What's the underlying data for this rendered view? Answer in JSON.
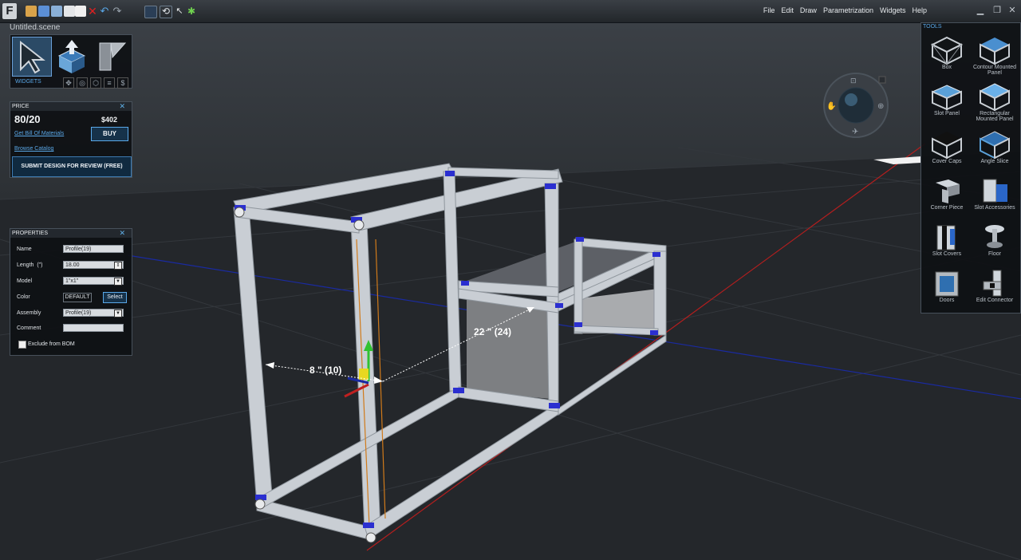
{
  "app": {
    "logo_letter": "F",
    "file_name": "Untitled.scene"
  },
  "menu": [
    "File",
    "Edit",
    "Draw",
    "Parametrization",
    "Widgets",
    "Help"
  ],
  "widgets": {
    "label": "WIDGETS"
  },
  "price": {
    "title": "PRICE",
    "brand": "80/20",
    "amount": "$402",
    "bom_link": "Get Bill Of Materials",
    "buy_label": "BUY",
    "catalog_link": "Browse Catalog",
    "submit_label": "SUBMIT DESIGN FOR REVIEW (FREE)"
  },
  "properties": {
    "title": "PROPERTIES",
    "name_label": "Name",
    "name_value": "Profile(19)",
    "length_label": "Length",
    "length_unit": "(\")",
    "length_value": "18.00",
    "model_label": "Model",
    "model_value": "1\"x1\"",
    "color_label": "Color",
    "color_value": "DEFAULT",
    "color_button": "Select",
    "assembly_label": "Assembly",
    "assembly_value": "Profile(19)",
    "comment_label": "Comment",
    "comment_value": "",
    "exclude_label": "Exclude from BOM"
  },
  "tools": {
    "title": "TOOLS",
    "items": [
      {
        "label": "Box",
        "icon": "box-frame-icon"
      },
      {
        "label": "Contour Mounted Panel",
        "icon": "contour-panel-icon"
      },
      {
        "label": "Slot Panel",
        "icon": "slot-panel-icon"
      },
      {
        "label": "Rectangular Mounted Panel",
        "icon": "rect-panel-icon"
      },
      {
        "label": "Cover Caps",
        "icon": "cover-caps-icon"
      },
      {
        "label": "Angle Slice",
        "icon": "angle-slice-icon"
      },
      {
        "label": "Corner Piece",
        "icon": "corner-piece-icon"
      },
      {
        "label": "Slot Accessories",
        "icon": "slot-accessories-icon"
      },
      {
        "label": "Slot Covers",
        "icon": "slot-covers-icon"
      },
      {
        "label": "Floor",
        "icon": "floor-icon"
      },
      {
        "label": "Doors",
        "icon": "doors-icon"
      },
      {
        "label": "Edit Connector",
        "icon": "edit-connector-icon"
      }
    ]
  },
  "dimensions": {
    "width_label": "8 \" (10)",
    "depth_label": "22 \" (24)"
  },
  "colors": {
    "accent": "#5aa8e8",
    "profile": "#c9ced4",
    "connector": "#2b2fd0",
    "panel": "#8a8a8a",
    "axis_red": "#c02020",
    "axis_blue": "#1a2aa0"
  }
}
